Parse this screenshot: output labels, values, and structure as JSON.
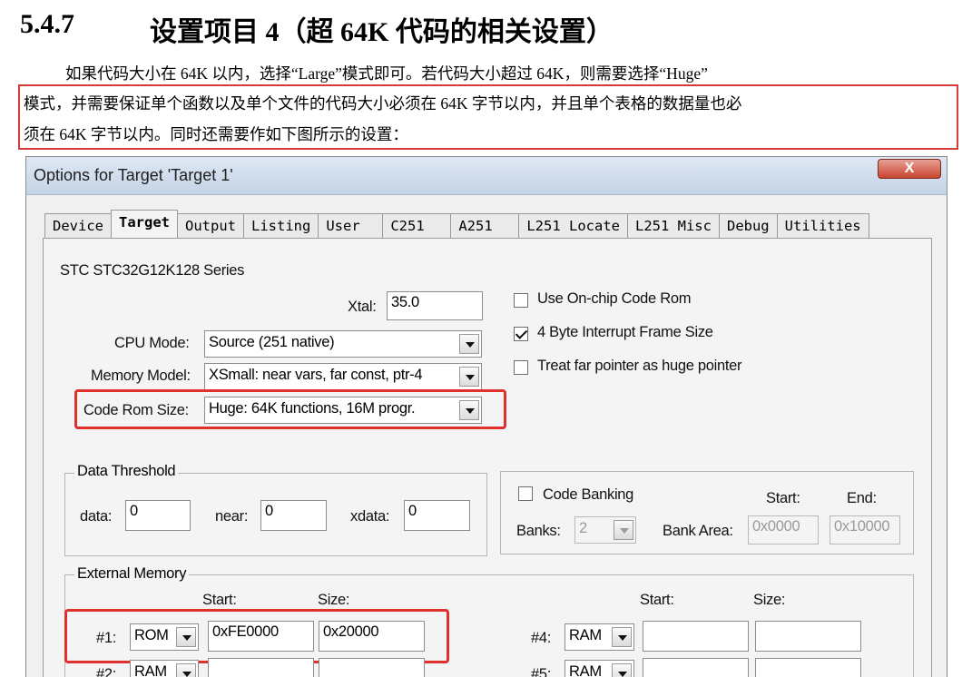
{
  "doc": {
    "section_number": "5.4.7",
    "section_title": "设置项目 4（超 64K 代码的相关设置）",
    "para_line1": "如果代码大小在 64K 以内，选择“Large”模式即可。若代码大小超过 64K，则需要选择“Huge”",
    "para_line2": "模式，并需要保证单个函数以及单个文件的代码大小必须在 64K 字节以内，并且单个表格的数据量也必",
    "para_line3": "须在 64K 字节以内。同时还需要作如下图所示的设置："
  },
  "dialog": {
    "title": "Options for Target 'Target 1'",
    "close_label": "X",
    "tabs": [
      "Device",
      "Target",
      "Output",
      "Listing",
      "User",
      "C251",
      "A251",
      "L251 Locate",
      "L251 Misc",
      "Debug",
      "Utilities"
    ],
    "active_tab": "Target",
    "device_name": "STC STC32G12K128 Series",
    "xtal_label": "Xtal:",
    "xtal_value": "35.0",
    "cpu_mode_label": "CPU Mode:",
    "cpu_mode_value": "Source (251 native)",
    "memory_model_label": "Memory Model:",
    "memory_model_value": "XSmall: near vars, far const, ptr-4",
    "code_rom_size_label": "Code Rom Size:",
    "code_rom_size_value": "Huge: 64K functions, 16M progr.",
    "opt_onchip_rom": "Use On-chip Code Rom",
    "opt_onchip_rom_checked": false,
    "opt_4byte_interrupt": "4 Byte Interrupt Frame Size",
    "opt_4byte_interrupt_checked": true,
    "opt_far_pointer": "Treat far pointer as huge pointer",
    "opt_far_pointer_checked": false,
    "data_threshold": {
      "title": "Data Threshold",
      "data_label": "data:",
      "data_value": "0",
      "near_label": "near:",
      "near_value": "0",
      "xdata_label": "xdata:",
      "xdata_value": "0"
    },
    "banking": {
      "code_banking_label": "Code Banking",
      "code_banking_checked": false,
      "start_label": "Start:",
      "end_label": "End:",
      "banks_label": "Banks:",
      "banks_value": "2",
      "bank_area_label": "Bank Area:",
      "bank_area_start": "0x0000",
      "bank_area_end": "0x10000"
    },
    "external_memory": {
      "title": "External Memory",
      "start_label": "Start:",
      "size_label": "Size:",
      "rows": [
        {
          "label": "#1:",
          "type": "ROM",
          "start": "0xFE0000",
          "size": "0x20000"
        },
        {
          "label": "#2:",
          "type": "RAM",
          "start": "",
          "size": ""
        },
        {
          "label": "#4:",
          "type": "RAM",
          "start": "",
          "size": ""
        },
        {
          "label": "#5:",
          "type": "RAM",
          "start": "",
          "size": ""
        }
      ]
    }
  },
  "colors": {
    "highlight_red": "#e0302e",
    "text_box_red": "#d43c3c"
  }
}
